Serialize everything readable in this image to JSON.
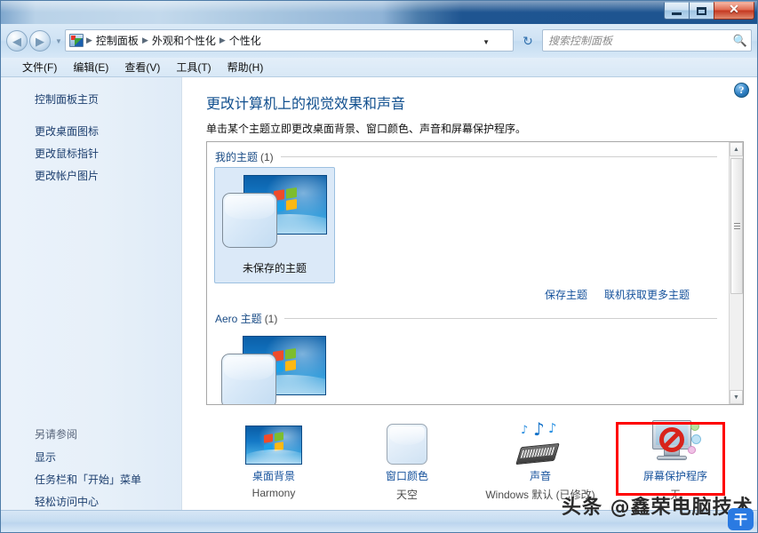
{
  "window": {
    "title": "",
    "buttons": {
      "minimize": "−",
      "maximize": "□",
      "close": "✕"
    }
  },
  "nav": {
    "back_icon": "◀",
    "forward_icon": "▶",
    "history_caret": "▼",
    "app_icon": "control-panel-icon",
    "breadcrumbs": [
      "控制面板",
      "外观和个性化",
      "个性化"
    ],
    "separator": "▶",
    "dropdown_caret": "▼",
    "refresh_icon": "↻"
  },
  "search": {
    "placeholder": "搜索控制面板",
    "value": "",
    "icon": "🔍"
  },
  "menubar": {
    "items": [
      {
        "label": "文件(F)"
      },
      {
        "label": "编辑(E)"
      },
      {
        "label": "查看(V)"
      },
      {
        "label": "工具(T)"
      },
      {
        "label": "帮助(H)"
      }
    ]
  },
  "sidebar": {
    "home_label": "控制面板主页",
    "links": [
      "更改桌面图标",
      "更改鼠标指针",
      "更改帐户图片"
    ],
    "see_also_header": "另请参阅",
    "see_also": [
      "显示",
      "任务栏和「开始」菜单",
      "轻松访问中心"
    ]
  },
  "content": {
    "help_glyph": "?",
    "title": "更改计算机上的视觉效果和声音",
    "subtitle": "单击某个主题立即更改桌面背景、窗口颜色、声音和屏幕保护程序。",
    "groups": [
      {
        "name": "我的主题",
        "count": "(1)"
      },
      {
        "name": "Aero 主题",
        "count": "(1)"
      }
    ],
    "themes": [
      {
        "name": "未保存的主题",
        "selected": true
      },
      {
        "name": "",
        "selected": false
      }
    ],
    "actions": [
      "保存主题",
      "联机获取更多主题"
    ],
    "scrollbar": {
      "up": "▲",
      "down": "▼"
    }
  },
  "settings_strip": [
    {
      "label": "桌面背景",
      "value": "Harmony",
      "icon": "wallpaper-icon"
    },
    {
      "label": "窗口颜色",
      "value": "天空",
      "icon": "window-color-icon"
    },
    {
      "label": "声音",
      "value": "Windows 默认 (已修改)",
      "icon": "sound-icon"
    },
    {
      "label": "屏幕保护程序",
      "value": "无",
      "icon": "screensaver-icon",
      "highlighted": true
    }
  ],
  "watermark": {
    "text": "头条 @鑫荣电脑技术",
    "logo": "干"
  },
  "colors": {
    "link": "#16529c",
    "title": "#12508f",
    "highlight_box": "#ff0000",
    "selection": "#dbe9f8"
  }
}
